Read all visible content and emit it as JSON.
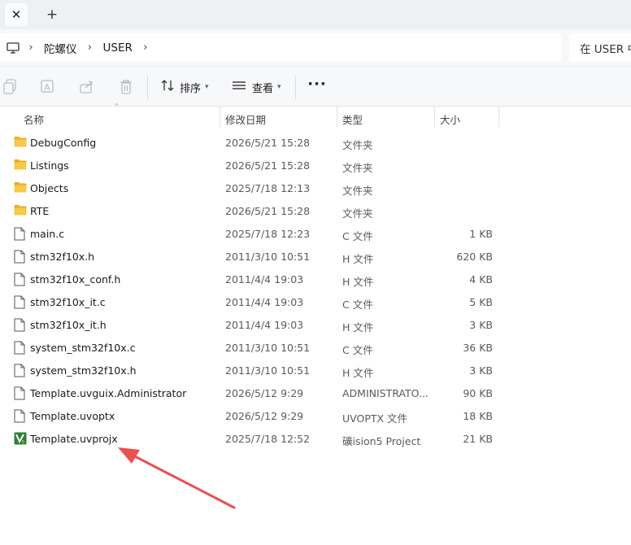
{
  "tabs": {
    "close_glyph": "✕",
    "new_glyph": "+"
  },
  "breadcrumb": {
    "items": [
      "陀螺仪",
      "USER"
    ],
    "separator": "›"
  },
  "search": {
    "placeholder": "在 USER 中"
  },
  "toolbar": {
    "sort_label": "排序",
    "view_label": "查看",
    "more_label": "···"
  },
  "columns": {
    "name": "名称",
    "date": "修改日期",
    "type": "类型",
    "size": "大小"
  },
  "files": [
    {
      "name": "DebugConfig",
      "date": "2026/5/21 15:28",
      "type": "文件夹",
      "size": "",
      "icon": "folder-icon"
    },
    {
      "name": "Listings",
      "date": "2026/5/21 15:28",
      "type": "文件夹",
      "size": "",
      "icon": "folder-icon"
    },
    {
      "name": "Objects",
      "date": "2025/7/18 12:13",
      "type": "文件夹",
      "size": "",
      "icon": "folder-icon"
    },
    {
      "name": "RTE",
      "date": "2026/5/21 15:28",
      "type": "文件夹",
      "size": "",
      "icon": "folder-icon"
    },
    {
      "name": "main.c",
      "date": "2025/7/18 12:23",
      "type": "C 文件",
      "size": "1 KB",
      "icon": "file-icon"
    },
    {
      "name": "stm32f10x.h",
      "date": "2011/3/10 10:51",
      "type": "H 文件",
      "size": "620 KB",
      "icon": "file-icon"
    },
    {
      "name": "stm32f10x_conf.h",
      "date": "2011/4/4 19:03",
      "type": "H 文件",
      "size": "4 KB",
      "icon": "file-icon"
    },
    {
      "name": "stm32f10x_it.c",
      "date": "2011/4/4 19:03",
      "type": "C 文件",
      "size": "5 KB",
      "icon": "file-icon"
    },
    {
      "name": "stm32f10x_it.h",
      "date": "2011/4/4 19:03",
      "type": "H 文件",
      "size": "3 KB",
      "icon": "file-icon"
    },
    {
      "name": "system_stm32f10x.c",
      "date": "2011/3/10 10:51",
      "type": "C 文件",
      "size": "36 KB",
      "icon": "file-icon"
    },
    {
      "name": "system_stm32f10x.h",
      "date": "2011/3/10 10:51",
      "type": "H 文件",
      "size": "3 KB",
      "icon": "file-icon"
    },
    {
      "name": "Template.uvguix.Administrator",
      "date": "2026/5/12 9:29",
      "type": "ADMINISTRATO...",
      "size": "90 KB",
      "icon": "file-icon"
    },
    {
      "name": "Template.uvoptx",
      "date": "2026/5/12 9:29",
      "type": "UVOPTX 文件",
      "size": "18 KB",
      "icon": "file-icon"
    },
    {
      "name": "Template.uvprojx",
      "date": "2025/7/18 12:52",
      "type": "礦ision5 Project",
      "size": "21 KB",
      "icon": "keil-project-icon"
    }
  ],
  "colors": {
    "folder": "#f7c948",
    "folder_dark": "#e8ad2a",
    "annotation_arrow": "#e8524f",
    "keil_green": "#2e7d32"
  }
}
